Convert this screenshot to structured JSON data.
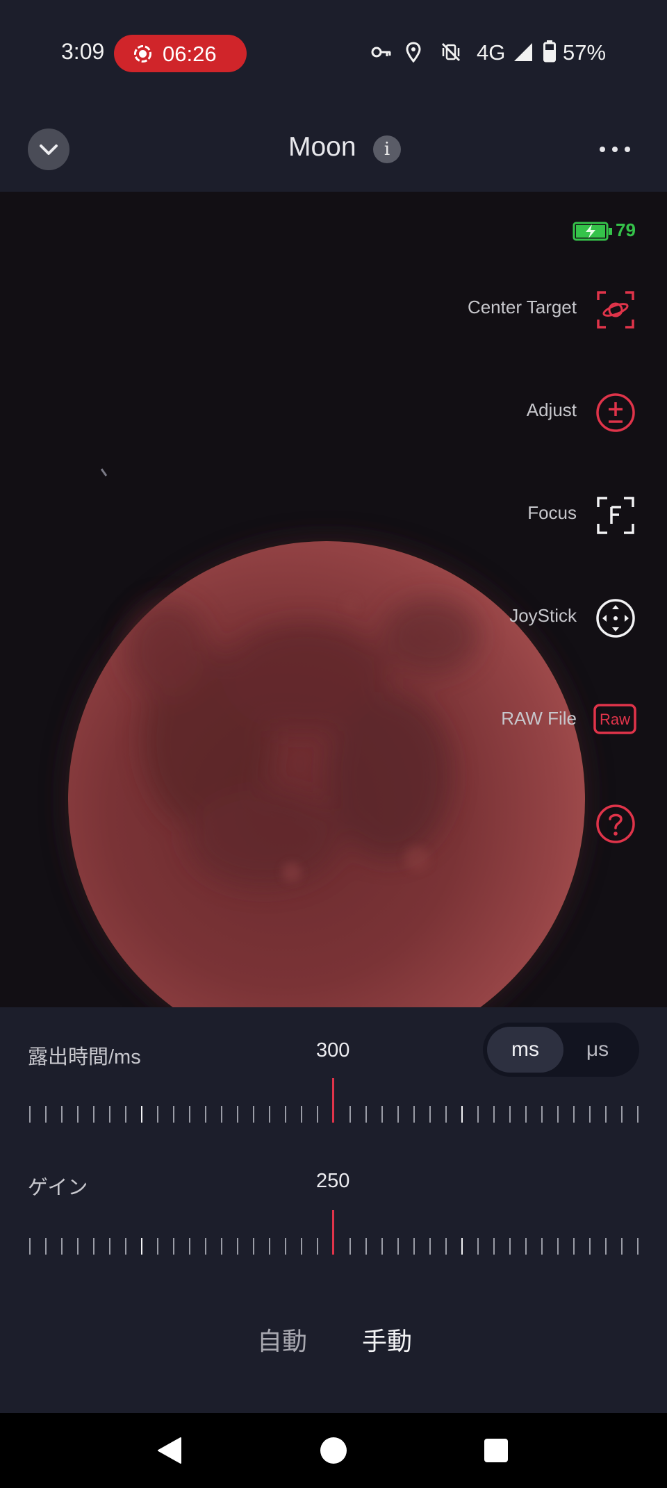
{
  "status_bar": {
    "time": "3:09",
    "recording_time": "06:26",
    "network": "4G",
    "battery": "57%",
    "icons": [
      "record-icon",
      "vpn-key-icon",
      "location-icon",
      "vibrate-off-icon",
      "signal-icon",
      "battery-icon"
    ]
  },
  "header": {
    "title": "Moon",
    "info_glyph": "i",
    "back_icon": "chevron-down-icon",
    "more_icon": "more-horizontal-icon"
  },
  "viewer": {
    "device_battery": "79",
    "tools": [
      {
        "label": "Center Target",
        "icon": "center-target-icon"
      },
      {
        "label": "Adjust",
        "icon": "adjust-plus-minus-icon"
      },
      {
        "label": "Focus",
        "icon": "focus-icon",
        "glyph": "F"
      },
      {
        "label": "JoyStick",
        "icon": "joystick-icon"
      },
      {
        "label": "RAW File",
        "icon": "raw-file-icon",
        "glyph": "Raw"
      },
      {
        "label": "",
        "icon": "help-icon",
        "glyph": "?"
      }
    ]
  },
  "controls": {
    "exposure": {
      "label": "露出時間/ms",
      "value": "300"
    },
    "unit_toggle": {
      "selected": "ms",
      "other": "μs"
    },
    "gain": {
      "label": "ゲイン",
      "value": "250"
    },
    "modes": {
      "auto": "自動",
      "manual": "手動",
      "selected": "manual"
    }
  },
  "navbar": {
    "back": "back-triangle-icon",
    "home": "home-circle-icon",
    "recents": "recents-square-icon"
  },
  "colors": {
    "accent": "#e0344a",
    "battery_green": "#35c34a",
    "panel_bg": "#1c1e2b",
    "recording_red": "#d0252a"
  }
}
